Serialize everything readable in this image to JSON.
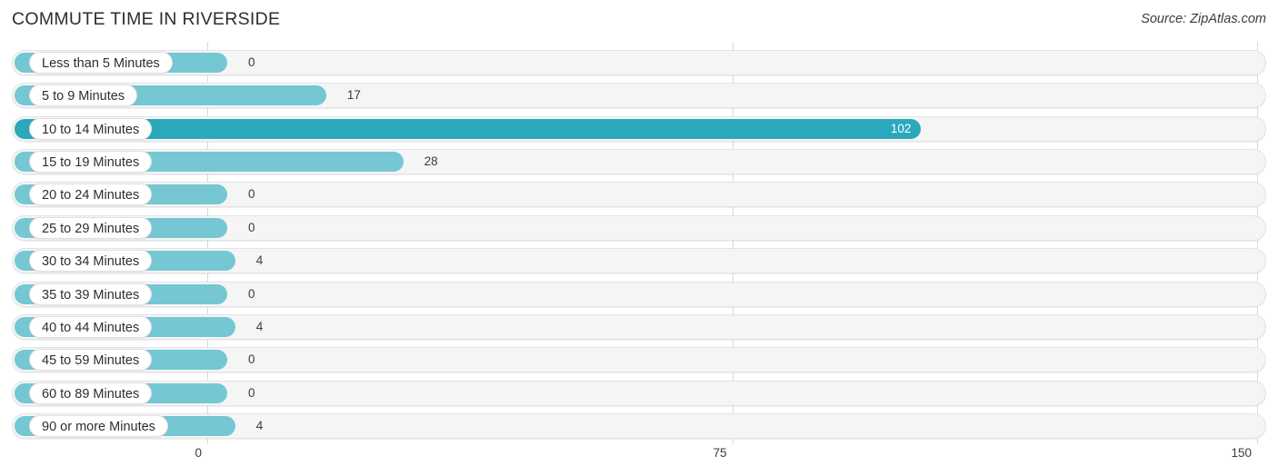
{
  "header": {
    "title": "COMMUTE TIME IN RIVERSIDE",
    "source": "Source: ZipAtlas.com"
  },
  "colors": {
    "bar": "#74c7d3",
    "bar_highlight": "#2ba8bc",
    "track": "#f5f5f5",
    "track_border": "#e3e3e6",
    "gridline": "#d9d9dd",
    "text": "#2d2d35",
    "value_text": "#3a3a44",
    "inside_value_text": "#ffffff"
  },
  "chart_data": {
    "type": "bar",
    "orientation": "horizontal",
    "title": "COMMUTE TIME IN RIVERSIDE",
    "subtitle": "",
    "xlabel": "",
    "ylabel": "",
    "xlim": [
      0,
      150
    ],
    "ticks": [
      "0",
      "75",
      "150"
    ],
    "tick_values": [
      0,
      75,
      150
    ],
    "grid": true,
    "legend": "none",
    "annotation": "Source: ZipAtlas.com",
    "categories": [
      "Less than 5 Minutes",
      "5 to 9 Minutes",
      "10 to 14 Minutes",
      "15 to 19 Minutes",
      "20 to 24 Minutes",
      "25 to 29 Minutes",
      "30 to 34 Minutes",
      "35 to 39 Minutes",
      "40 to 44 Minutes",
      "45 to 59 Minutes",
      "60 to 89 Minutes",
      "90 or more Minutes"
    ],
    "values": [
      0,
      17,
      102,
      28,
      0,
      0,
      4,
      0,
      4,
      0,
      0,
      4
    ],
    "value_labels": [
      "0",
      "17",
      "102",
      "28",
      "0",
      "0",
      "4",
      "0",
      "4",
      "0",
      "0",
      "4"
    ],
    "max_value": 102,
    "highlight_index": 2
  }
}
